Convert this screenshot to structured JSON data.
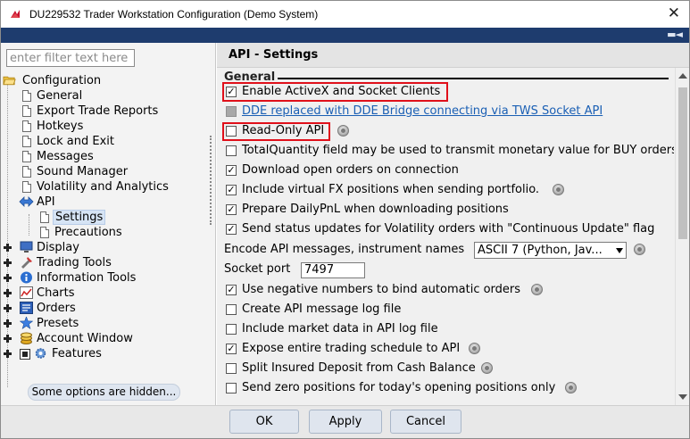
{
  "window": {
    "title": "DU229532 Trader Workstation Configuration (Demo System)",
    "close_glyph": "✕",
    "pin_glyph": "▬◄"
  },
  "sidebar": {
    "filter_placeholder": "enter filter text here",
    "tree": {
      "root": "Configuration",
      "items": [
        "General",
        "Export Trade Reports",
        "Hotkeys",
        "Lock and Exit",
        "Messages",
        "Sound Manager",
        "Volatility and Analytics"
      ],
      "api": {
        "label": "API",
        "children": [
          "Settings",
          "Precautions"
        ]
      },
      "groups": [
        "Display",
        "Trading Tools",
        "Information Tools",
        "Charts",
        "Orders",
        "Presets",
        "Account Window",
        "Features"
      ]
    },
    "hidden_options": "Some options are hidden..."
  },
  "main": {
    "panel_title": "API - Settings",
    "section": "General",
    "rows": [
      {
        "label": "Enable ActiveX and Socket Clients",
        "checked": true
      },
      {
        "label": "DDE replaced with DDE Bridge connecting via TWS Socket API",
        "checked": false,
        "disabled": true,
        "link": true
      },
      {
        "label": "Read-Only API",
        "checked": false,
        "info": true
      },
      {
        "label": "TotalQuantity field may be used to transmit monetary value for BUY orders",
        "checked": false
      },
      {
        "label": "Download open orders on connection",
        "checked": true
      },
      {
        "label": "Include virtual FX positions when sending portfolio.",
        "checked": true,
        "info": true
      },
      {
        "label": "Prepare DailyPnL when downloading positions",
        "checked": true
      },
      {
        "label": "Send status updates for Volatility orders with \"Continuous Update\" flag",
        "checked": true
      }
    ],
    "encode": {
      "label": "Encode API messages, instrument names",
      "value": "ASCII 7 (Python, Jav..."
    },
    "socket": {
      "label": "Socket port",
      "value": "7497"
    },
    "rows2": [
      {
        "label": "Use negative numbers to bind automatic orders",
        "checked": true,
        "info": true
      },
      {
        "label": "Create API message log file",
        "checked": false
      },
      {
        "label": "Include market data in API log file",
        "checked": false
      },
      {
        "label": "Expose entire trading schedule to API",
        "checked": true,
        "info": true
      },
      {
        "label": "Split Insured Deposit from Cash Balance",
        "checked": false,
        "info": true
      },
      {
        "label": "Send zero positions for today's opening positions only",
        "checked": false,
        "info": true
      }
    ]
  },
  "buttons": {
    "ok": "OK",
    "apply": "Apply",
    "cancel": "Cancel"
  },
  "colors": {
    "accent_blue": "#1e3c6e",
    "highlight_red": "#e0101a",
    "link_blue": "#1a5fb4"
  }
}
